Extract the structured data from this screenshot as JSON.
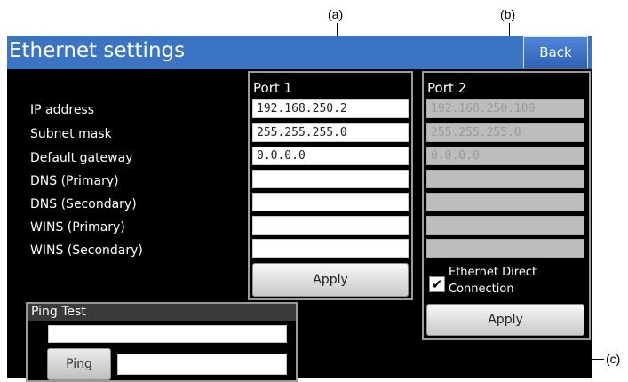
{
  "header": {
    "title": "Ethernet settings",
    "back_label": "Back"
  },
  "labels": [
    "IP address",
    "Subnet mask",
    "Default gateway",
    "DNS (Primary)",
    "DNS (Secondary)",
    "WINS (Primary)",
    "WINS (Secondary)"
  ],
  "port1": {
    "title": "Port 1",
    "fields": [
      "192.168.250.2",
      "255.255.255.0",
      "0.0.0.0",
      "",
      "",
      "",
      ""
    ],
    "apply_label": "Apply"
  },
  "port2": {
    "title": "Port 2",
    "fields": [
      "192.168.250.100",
      "255.255.255.0",
      "0.0.0.0",
      "",
      "",
      "",
      ""
    ],
    "direct_connection_label_1": "Ethernet Direct",
    "direct_connection_label_2": "Connection",
    "direct_connection_checked": true,
    "check_mark": "✔",
    "apply_label": "Apply"
  },
  "ping": {
    "title": "Ping Test",
    "address_value": "",
    "button_label": "Ping",
    "result_value": ""
  },
  "callouts": {
    "a": "(a)",
    "b": "(b)",
    "c": "(c)"
  },
  "colors": {
    "title_bar": "#3c74c4",
    "screen_bg": "#000000",
    "disabled_field": "#bdbdbd"
  }
}
